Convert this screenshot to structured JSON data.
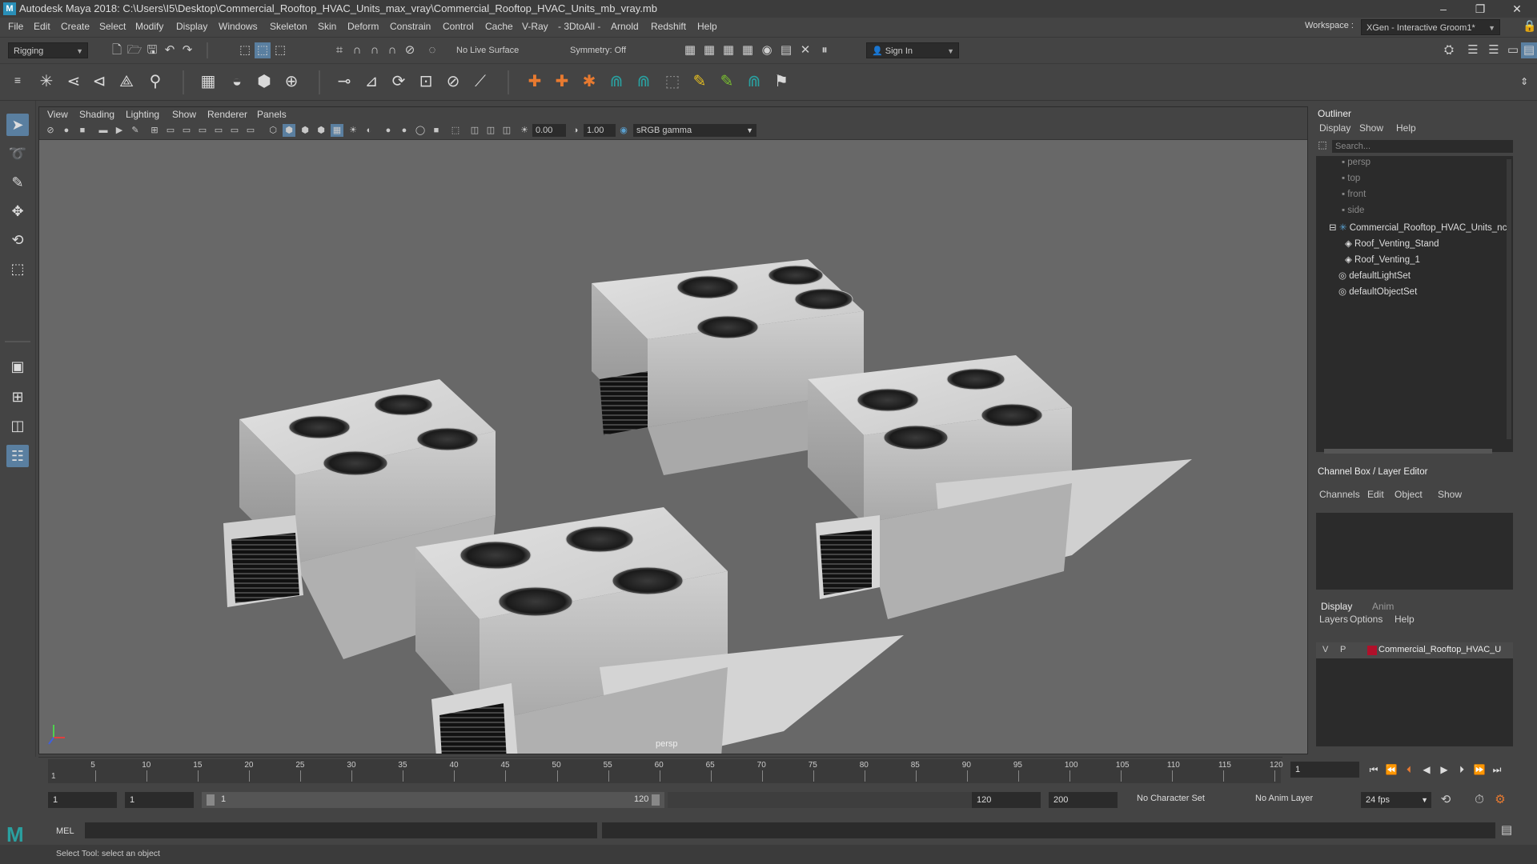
{
  "window": {
    "title": "Autodesk Maya 2018: C:\\Users\\I5\\Desktop\\Commercial_Rooftop_HVAC_Units_max_vray\\Commercial_Rooftop_HVAC_Units_mb_vray.mb",
    "logo_text": "M",
    "minimize": "–",
    "maximize": "❐",
    "close": "✕"
  },
  "menubar": {
    "items": [
      "File",
      "Edit",
      "Create",
      "Select",
      "Modify",
      "Display",
      "Windows",
      "Skeleton",
      "Skin",
      "Deform",
      "Constrain",
      "Control",
      "Cache",
      "V-Ray",
      "- 3DtoAll -",
      "Arnold",
      "Redshift",
      "Help"
    ],
    "workspace_label": "Workspace :",
    "workspace_value": "XGen - Interactive Groom1*"
  },
  "toolbar": {
    "menuset": "Rigging",
    "live_surface": "No Live Surface",
    "symmetry": "Symmetry: Off",
    "sign_in": "Sign In"
  },
  "viewport": {
    "menus": [
      "View",
      "Shading",
      "Lighting",
      "Show",
      "Renderer",
      "Panels"
    ],
    "exposure": "0.00",
    "gamma": "1.00",
    "color_space": "sRGB gamma",
    "camera_label": "persp"
  },
  "outliner": {
    "title": "Outliner",
    "menus": [
      "Display",
      "Show",
      "Help"
    ],
    "search_placeholder": "Search...",
    "items": [
      {
        "label": "persp",
        "type": "camera"
      },
      {
        "label": "top",
        "type": "camera"
      },
      {
        "label": "front",
        "type": "camera"
      },
      {
        "label": "side",
        "type": "camera"
      },
      {
        "label": "Commercial_Rooftop_HVAC_Units_nc",
        "type": "group"
      },
      {
        "label": "Roof_Venting_Stand",
        "type": "mesh"
      },
      {
        "label": "Roof_Venting_1",
        "type": "mesh"
      },
      {
        "label": "defaultLightSet",
        "type": "set"
      },
      {
        "label": "defaultObjectSet",
        "type": "set"
      }
    ]
  },
  "channel_box": {
    "title": "Channel Box / Layer Editor",
    "menus": [
      "Channels",
      "Edit",
      "Object",
      "Show"
    ]
  },
  "layer_editor": {
    "tabs": [
      "Display",
      "Anim"
    ],
    "menus": [
      "Layers",
      "Options",
      "Help"
    ],
    "layer": {
      "v": "V",
      "p": "P",
      "name": "Commercial_Rooftop_HVAC_U",
      "color": "#b0102a"
    }
  },
  "timeline": {
    "ticks": [
      "5",
      "10",
      "15",
      "20",
      "25",
      "30",
      "35",
      "40",
      "45",
      "50",
      "55",
      "60",
      "65",
      "70",
      "75",
      "80",
      "85",
      "90",
      "95",
      "100",
      "105",
      "110",
      "115",
      "120"
    ],
    "start_label": "1",
    "current_frame": "1"
  },
  "range": {
    "start": "1",
    "anim_start": "1",
    "range_start": "1",
    "range_end": "120",
    "end": "120",
    "anim_end": "200",
    "character_set": "No Character Set",
    "anim_layer": "No Anim Layer",
    "fps": "24 fps"
  },
  "command": {
    "label": "MEL",
    "help_text": "Select Tool: select an object"
  },
  "colors": {
    "accent": "#5aa0d0",
    "layer_red": "#b0102a",
    "viewport_bg": "#686868"
  }
}
